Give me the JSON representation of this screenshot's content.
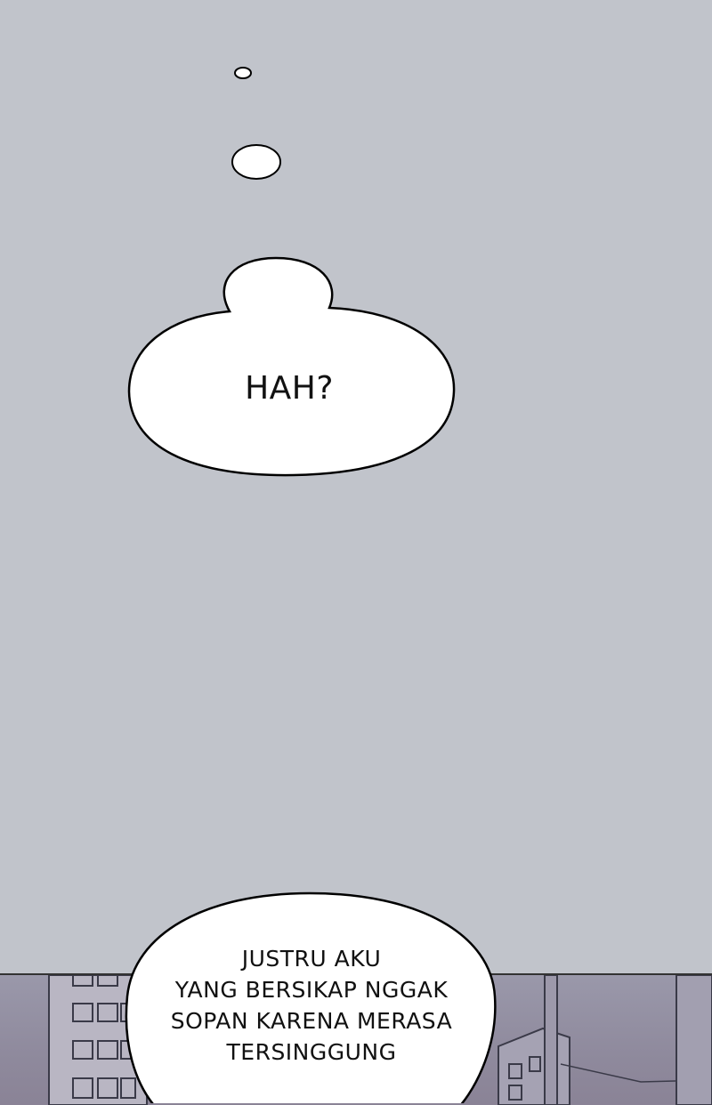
{
  "bubbles": {
    "hah": {
      "text": "HAH?"
    },
    "justru": {
      "lines": [
        "JUSTRU AKU",
        "YANG BERSIKAP NGGAK",
        "SOPAN KARENA MERASA",
        "TERSINGGUNG"
      ]
    }
  },
  "colors": {
    "background": "#c1c4cb",
    "bubble_fill": "#ffffff",
    "bubble_stroke": "#000000",
    "buildings_sky": "#8f8a9d"
  }
}
